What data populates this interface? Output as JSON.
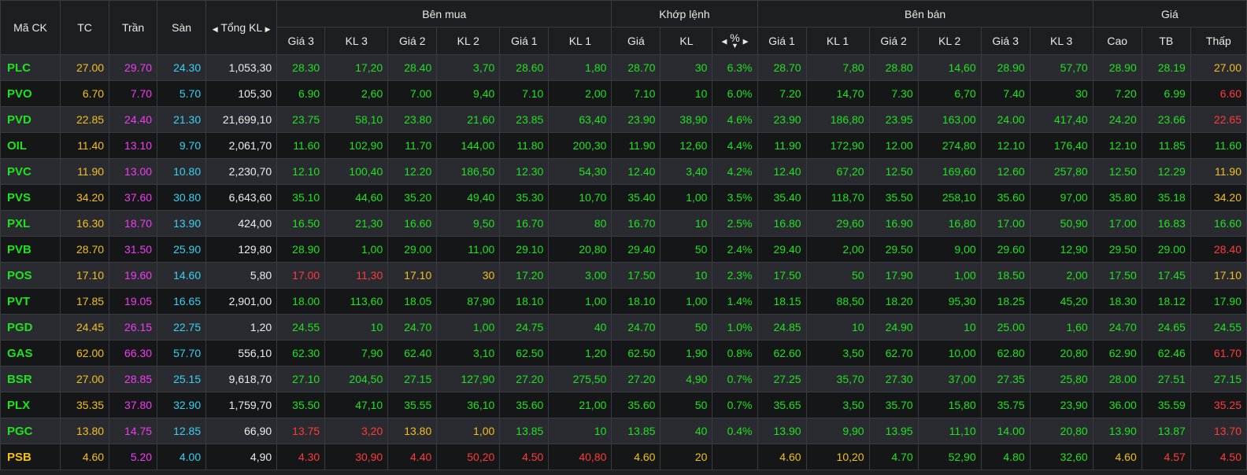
{
  "headers": {
    "symbol": "Mã CK",
    "ref": "TC",
    "ceil": "Trần",
    "floor": "Sàn",
    "total_vol": "Tổng KL",
    "buy_group": "Bên mua",
    "match_group": "Khớp lệnh",
    "sell_group": "Bên bán",
    "price_group": "Giá",
    "buy_cols": [
      "Giá 3",
      "KL 3",
      "Giá 2",
      "KL 2",
      "Giá 1",
      "KL 1"
    ],
    "match_cols": [
      "Giá",
      "KL",
      "%"
    ],
    "sell_cols": [
      "Giá 1",
      "KL 1",
      "Giá 2",
      "KL 2",
      "Giá 3",
      "KL 3"
    ],
    "price_cols": [
      "Cao",
      "TB",
      "Thấp"
    ]
  },
  "colors": {
    "up": "#1ee31e",
    "ref": "#f2c01a",
    "ceil": "#f23cf2",
    "floor": "#35d2f2",
    "down": "#ff3b3b",
    "neutral": "#ececec"
  },
  "rows": [
    {
      "sym": "PLC",
      "tc": "27.00",
      "tran": "29.70",
      "san": "24.30",
      "tkl": "1,053,30",
      "b3": "28.30",
      "bk3": "17,20",
      "b2": "28.40",
      "bk2": "3,70",
      "b1": "28.60",
      "bk1": "1,80",
      "mp": "28.70",
      "mk": "30",
      "pct": "6.3%",
      "s1": "28.70",
      "sk1": "7,80",
      "s2": "28.80",
      "sk2": "14,60",
      "s3": "28.90",
      "sk3": "57,70",
      "cao": "28.90",
      "tb": "28.19",
      "thap": "27.00",
      "cls": {
        "sym": "up",
        "b3": "up",
        "b2": "up",
        "b1": "up",
        "mp": "up",
        "s1": "up",
        "s2": "up",
        "s3": "up",
        "cao": "up",
        "tb": "up",
        "thap": "ref"
      }
    },
    {
      "sym": "PVO",
      "tc": "6.70",
      "tran": "7.70",
      "san": "5.70",
      "tkl": "105,30",
      "b3": "6.90",
      "bk3": "2,60",
      "b2": "7.00",
      "bk2": "9,40",
      "b1": "7.10",
      "bk1": "2,00",
      "mp": "7.10",
      "mk": "10",
      "pct": "6.0%",
      "s1": "7.20",
      "sk1": "14,70",
      "s2": "7.30",
      "sk2": "6,70",
      "s3": "7.40",
      "sk3": "30",
      "cao": "7.20",
      "tb": "6.99",
      "thap": "6.60",
      "cls": {
        "sym": "up",
        "b3": "up",
        "b2": "up",
        "b1": "up",
        "mp": "up",
        "s1": "up",
        "s2": "up",
        "s3": "up",
        "cao": "up",
        "tb": "up",
        "thap": "down"
      }
    },
    {
      "sym": "PVD",
      "tc": "22.85",
      "tran": "24.40",
      "san": "21.30",
      "tkl": "21,699,10",
      "b3": "23.75",
      "bk3": "58,10",
      "b2": "23.80",
      "bk2": "21,60",
      "b1": "23.85",
      "bk1": "63,40",
      "mp": "23.90",
      "mk": "38,90",
      "pct": "4.6%",
      "s1": "23.90",
      "sk1": "186,80",
      "s2": "23.95",
      "sk2": "163,00",
      "s3": "24.00",
      "sk3": "417,40",
      "cao": "24.20",
      "tb": "23.66",
      "thap": "22.65",
      "cls": {
        "sym": "up",
        "b3": "up",
        "b2": "up",
        "b1": "up",
        "mp": "up",
        "s1": "up",
        "s2": "up",
        "s3": "up",
        "cao": "up",
        "tb": "up",
        "thap": "down"
      }
    },
    {
      "sym": "OIL",
      "tc": "11.40",
      "tran": "13.10",
      "san": "9.70",
      "tkl": "2,061,70",
      "b3": "11.60",
      "bk3": "102,90",
      "b2": "11.70",
      "bk2": "144,00",
      "b1": "11.80",
      "bk1": "200,30",
      "mp": "11.90",
      "mk": "12,60",
      "pct": "4.4%",
      "s1": "11.90",
      "sk1": "172,90",
      "s2": "12.00",
      "sk2": "274,80",
      "s3": "12.10",
      "sk3": "176,40",
      "cao": "12.10",
      "tb": "11.85",
      "thap": "11.60",
      "cls": {
        "sym": "up",
        "b3": "up",
        "b2": "up",
        "b1": "up",
        "mp": "up",
        "s1": "up",
        "s2": "up",
        "s3": "up",
        "cao": "up",
        "tb": "up",
        "thap": "up"
      }
    },
    {
      "sym": "PVC",
      "tc": "11.90",
      "tran": "13.00",
      "san": "10.80",
      "tkl": "2,230,70",
      "b3": "12.10",
      "bk3": "100,40",
      "b2": "12.20",
      "bk2": "186,50",
      "b1": "12.30",
      "bk1": "54,30",
      "mp": "12.40",
      "mk": "3,40",
      "pct": "4.2%",
      "s1": "12.40",
      "sk1": "67,20",
      "s2": "12.50",
      "sk2": "169,60",
      "s3": "12.60",
      "sk3": "257,80",
      "cao": "12.50",
      "tb": "12.29",
      "thap": "11.90",
      "cls": {
        "sym": "up",
        "b3": "up",
        "b2": "up",
        "b1": "up",
        "mp": "up",
        "s1": "up",
        "s2": "up",
        "s3": "up",
        "cao": "up",
        "tb": "up",
        "thap": "ref"
      }
    },
    {
      "sym": "PVS",
      "tc": "34.20",
      "tran": "37.60",
      "san": "30.80",
      "tkl": "6,643,60",
      "b3": "35.10",
      "bk3": "44,60",
      "b2": "35.20",
      "bk2": "49,40",
      "b1": "35.30",
      "bk1": "10,70",
      "mp": "35.40",
      "mk": "1,00",
      "pct": "3.5%",
      "s1": "35.40",
      "sk1": "118,70",
      "s2": "35.50",
      "sk2": "258,10",
      "s3": "35.60",
      "sk3": "97,00",
      "cao": "35.80",
      "tb": "35.18",
      "thap": "34.20",
      "cls": {
        "sym": "up",
        "b3": "up",
        "b2": "up",
        "b1": "up",
        "mp": "up",
        "s1": "up",
        "s2": "up",
        "s3": "up",
        "cao": "up",
        "tb": "up",
        "thap": "ref"
      }
    },
    {
      "sym": "PXL",
      "tc": "16.30",
      "tran": "18.70",
      "san": "13.90",
      "tkl": "424,00",
      "b3": "16.50",
      "bk3": "21,30",
      "b2": "16.60",
      "bk2": "9,50",
      "b1": "16.70",
      "bk1": "80",
      "mp": "16.70",
      "mk": "10",
      "pct": "2.5%",
      "s1": "16.80",
      "sk1": "29,60",
      "s2": "16.90",
      "sk2": "16,80",
      "s3": "17.00",
      "sk3": "50,90",
      "cao": "17.00",
      "tb": "16.83",
      "thap": "16.60",
      "cls": {
        "sym": "up",
        "b3": "up",
        "b2": "up",
        "b1": "up",
        "mp": "up",
        "s1": "up",
        "s2": "up",
        "s3": "up",
        "cao": "up",
        "tb": "up",
        "thap": "up"
      }
    },
    {
      "sym": "PVB",
      "tc": "28.70",
      "tran": "31.50",
      "san": "25.90",
      "tkl": "129,80",
      "b3": "28.90",
      "bk3": "1,00",
      "b2": "29.00",
      "bk2": "11,00",
      "b1": "29.10",
      "bk1": "20,80",
      "mp": "29.40",
      "mk": "50",
      "pct": "2.4%",
      "s1": "29.40",
      "sk1": "2,00",
      "s2": "29.50",
      "sk2": "9,00",
      "s3": "29.60",
      "sk3": "12,90",
      "cao": "29.50",
      "tb": "29.00",
      "thap": "28.40",
      "cls": {
        "sym": "up",
        "b3": "up",
        "b2": "up",
        "b1": "up",
        "mp": "up",
        "s1": "up",
        "s2": "up",
        "s3": "up",
        "cao": "up",
        "tb": "up",
        "thap": "down"
      }
    },
    {
      "sym": "POS",
      "tc": "17.10",
      "tran": "19.60",
      "san": "14.60",
      "tkl": "5,80",
      "b3": "17.00",
      "bk3": "11,30",
      "b2": "17.10",
      "bk2": "30",
      "b1": "17.20",
      "bk1": "3,00",
      "mp": "17.50",
      "mk": "10",
      "pct": "2.3%",
      "s1": "17.50",
      "sk1": "50",
      "s2": "17.90",
      "sk2": "1,00",
      "s3": "18.50",
      "sk3": "2,00",
      "cao": "17.50",
      "tb": "17.45",
      "thap": "17.10",
      "cls": {
        "sym": "up",
        "b3": "down",
        "b2": "ref",
        "b1": "up",
        "mp": "up",
        "s1": "up",
        "s2": "up",
        "s3": "up",
        "cao": "up",
        "tb": "up",
        "thap": "ref"
      }
    },
    {
      "sym": "PVT",
      "tc": "17.85",
      "tran": "19.05",
      "san": "16.65",
      "tkl": "2,901,00",
      "b3": "18.00",
      "bk3": "113,60",
      "b2": "18.05",
      "bk2": "87,90",
      "b1": "18.10",
      "bk1": "1,00",
      "mp": "18.10",
      "mk": "1,00",
      "pct": "1.4%",
      "s1": "18.15",
      "sk1": "88,50",
      "s2": "18.20",
      "sk2": "95,30",
      "s3": "18.25",
      "sk3": "45,20",
      "cao": "18.30",
      "tb": "18.12",
      "thap": "17.90",
      "cls": {
        "sym": "up",
        "b3": "up",
        "b2": "up",
        "b1": "up",
        "mp": "up",
        "s1": "up",
        "s2": "up",
        "s3": "up",
        "cao": "up",
        "tb": "up",
        "thap": "up"
      }
    },
    {
      "sym": "PGD",
      "tc": "24.45",
      "tran": "26.15",
      "san": "22.75",
      "tkl": "1,20",
      "b3": "24.55",
      "bk3": "10",
      "b2": "24.70",
      "bk2": "1,00",
      "b1": "24.75",
      "bk1": "40",
      "mp": "24.70",
      "mk": "50",
      "pct": "1.0%",
      "s1": "24.85",
      "sk1": "10",
      "s2": "24.90",
      "sk2": "10",
      "s3": "25.00",
      "sk3": "1,60",
      "cao": "24.70",
      "tb": "24.65",
      "thap": "24.55",
      "cls": {
        "sym": "up",
        "b3": "up",
        "b2": "up",
        "b1": "up",
        "mp": "up",
        "s1": "up",
        "s2": "up",
        "s3": "up",
        "cao": "up",
        "tb": "up",
        "thap": "up"
      }
    },
    {
      "sym": "GAS",
      "tc": "62.00",
      "tran": "66.30",
      "san": "57.70",
      "tkl": "556,10",
      "b3": "62.30",
      "bk3": "7,90",
      "b2": "62.40",
      "bk2": "3,10",
      "b1": "62.50",
      "bk1": "1,20",
      "mp": "62.50",
      "mk": "1,90",
      "pct": "0.8%",
      "s1": "62.60",
      "sk1": "3,50",
      "s2": "62.70",
      "sk2": "10,00",
      "s3": "62.80",
      "sk3": "20,80",
      "cao": "62.90",
      "tb": "62.46",
      "thap": "61.70",
      "cls": {
        "sym": "up",
        "b3": "up",
        "b2": "up",
        "b1": "up",
        "mp": "up",
        "s1": "up",
        "s2": "up",
        "s3": "up",
        "cao": "up",
        "tb": "up",
        "thap": "down"
      }
    },
    {
      "sym": "BSR",
      "tc": "27.00",
      "tran": "28.85",
      "san": "25.15",
      "tkl": "9,618,70",
      "b3": "27.10",
      "bk3": "204,50",
      "b2": "27.15",
      "bk2": "127,90",
      "b1": "27.20",
      "bk1": "275,50",
      "mp": "27.20",
      "mk": "4,90",
      "pct": "0.7%",
      "s1": "27.25",
      "sk1": "35,70",
      "s2": "27.30",
      "sk2": "37,00",
      "s3": "27.35",
      "sk3": "25,80",
      "cao": "28.00",
      "tb": "27.51",
      "thap": "27.15",
      "cls": {
        "sym": "up",
        "b3": "up",
        "b2": "up",
        "b1": "up",
        "mp": "up",
        "s1": "up",
        "s2": "up",
        "s3": "up",
        "cao": "up",
        "tb": "up",
        "thap": "up"
      }
    },
    {
      "sym": "PLX",
      "tc": "35.35",
      "tran": "37.80",
      "san": "32.90",
      "tkl": "1,759,70",
      "b3": "35.50",
      "bk3": "47,10",
      "b2": "35.55",
      "bk2": "36,10",
      "b1": "35.60",
      "bk1": "21,00",
      "mp": "35.60",
      "mk": "50",
      "pct": "0.7%",
      "s1": "35.65",
      "sk1": "3,50",
      "s2": "35.70",
      "sk2": "15,80",
      "s3": "35.75",
      "sk3": "23,90",
      "cao": "36.00",
      "tb": "35.59",
      "thap": "35.25",
      "cls": {
        "sym": "up",
        "b3": "up",
        "b2": "up",
        "b1": "up",
        "mp": "up",
        "s1": "up",
        "s2": "up",
        "s3": "up",
        "cao": "up",
        "tb": "up",
        "thap": "down"
      }
    },
    {
      "sym": "PGC",
      "tc": "13.80",
      "tran": "14.75",
      "san": "12.85",
      "tkl": "66,90",
      "b3": "13.75",
      "bk3": "3,20",
      "b2": "13.80",
      "bk2": "1,00",
      "b1": "13.85",
      "bk1": "10",
      "mp": "13.85",
      "mk": "40",
      "pct": "0.4%",
      "s1": "13.90",
      "sk1": "9,90",
      "s2": "13.95",
      "sk2": "11,10",
      "s3": "14.00",
      "sk3": "20,80",
      "cao": "13.90",
      "tb": "13.87",
      "thap": "13.70",
      "cls": {
        "sym": "up",
        "b3": "down",
        "b2": "ref",
        "b1": "up",
        "mp": "up",
        "s1": "up",
        "s2": "up",
        "s3": "up",
        "cao": "up",
        "tb": "up",
        "thap": "down"
      }
    },
    {
      "sym": "PSB",
      "tc": "4.60",
      "tran": "5.20",
      "san": "4.00",
      "tkl": "4,90",
      "b3": "4.30",
      "bk3": "30,90",
      "b2": "4.40",
      "bk2": "50,20",
      "b1": "4.50",
      "bk1": "40,80",
      "mp": "4.60",
      "mk": "20",
      "pct": "",
      "s1": "4.60",
      "sk1": "10,20",
      "s2": "4.70",
      "sk2": "52,90",
      "s3": "4.80",
      "sk3": "32,60",
      "cao": "4.60",
      "tb": "4.57",
      "thap": "4.50",
      "cls": {
        "sym": "ref",
        "b3": "down",
        "b2": "down",
        "b1": "down",
        "mp": "ref",
        "s1": "ref",
        "s2": "up",
        "s3": "up",
        "cao": "ref",
        "tb": "down",
        "thap": "down"
      }
    }
  ]
}
